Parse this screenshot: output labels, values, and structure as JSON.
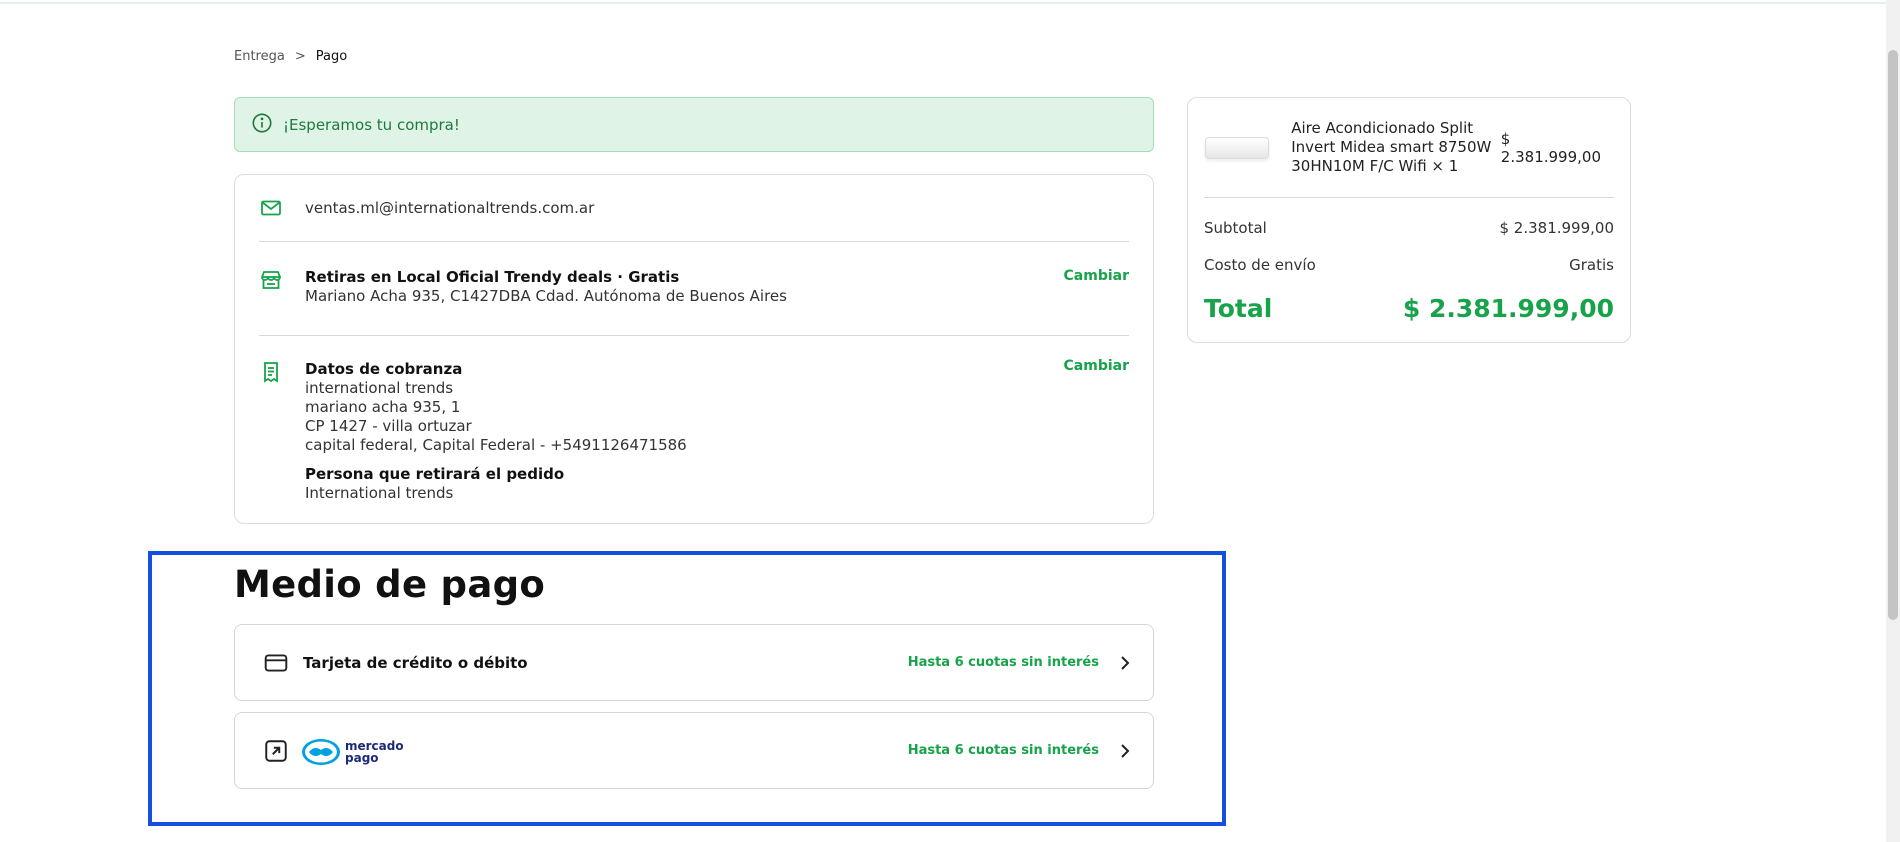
{
  "breadcrumb": {
    "step1": "Entrega",
    "separator": ">",
    "step2": "Pago"
  },
  "notice": {
    "text": "¡Esperamos tu compra!"
  },
  "contact": {
    "email": "ventas.ml@internationaltrends.com.ar"
  },
  "shipping": {
    "title": "Retiras en Local Oficial Trendy deals · Gratis",
    "address": "Mariano Acha 935, C1427DBA Cdad. Autónoma de Buenos Aires",
    "change_label": "Cambiar"
  },
  "billing": {
    "title": "Datos de cobranza",
    "lines": [
      "international trends",
      "mariano acha 935, 1",
      "CP 1427 - villa ortuzar",
      "capital federal, Capital Federal - +5491126471586"
    ],
    "pickup_title": "Persona que retirará el pedido",
    "pickup_name": "International trends",
    "change_label": "Cambiar"
  },
  "payment": {
    "title": "Medio de pago",
    "options": [
      {
        "label": "Tarjeta de crédito o débito",
        "installments": "Hasta 6 cuotas sin interés",
        "icon": "credit-card-icon"
      },
      {
        "label": "mercado pago",
        "installments": "Hasta 6 cuotas sin interés",
        "icon": "external-link-icon"
      }
    ],
    "mp_logo_line1": "mercado",
    "mp_logo_line2": "pago"
  },
  "summary": {
    "product_name": "Aire Acondicionado Split Invert Midea smart 8750W 30HN10M F/C Wifi × 1",
    "product_price": "$ 2.381.999,00",
    "subtotal_label": "Subtotal",
    "subtotal_value": "$ 2.381.999,00",
    "shipping_label": "Costo de envío",
    "shipping_value": "Gratis",
    "total_label": "Total",
    "total_value": "$ 2.381.999,00"
  },
  "colors": {
    "accent": "#16a34a",
    "notice_bg": "#dff3e7",
    "highlight_border": "#1350e0"
  }
}
